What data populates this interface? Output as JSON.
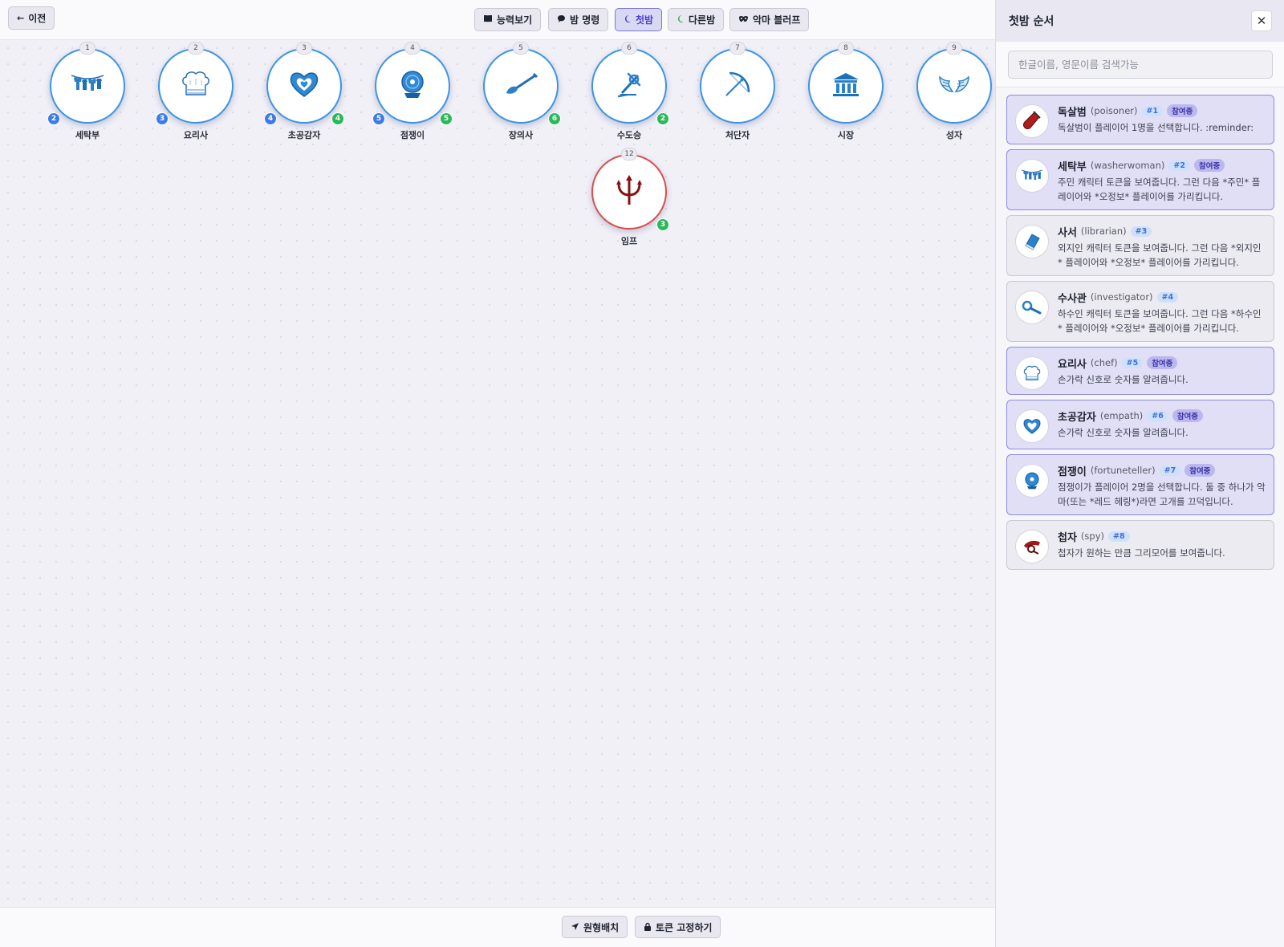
{
  "toolbar": {
    "back_label": "이전",
    "tabs": [
      {
        "label": "능력보기",
        "icon": "book-icon",
        "active": false
      },
      {
        "label": "밤 명령",
        "icon": "chat-bubble-icon",
        "active": false
      },
      {
        "label": "첫밤",
        "icon": "moon-icon",
        "active": true
      },
      {
        "label": "다른밤",
        "icon": "moon-icon",
        "active": false
      },
      {
        "label": "악마 블러프",
        "icon": "mask-icon",
        "active": false
      }
    ]
  },
  "tokens": [
    {
      "seat": "1",
      "name": "세탁부",
      "icon": "laundry-icon",
      "team": "good",
      "order": "2",
      "reminders": ""
    },
    {
      "seat": "2",
      "name": "요리사",
      "icon": "chef-hat-icon",
      "team": "good",
      "order": "3",
      "reminders": ""
    },
    {
      "seat": "3",
      "name": "초공감자",
      "icon": "heart-icon",
      "team": "good",
      "order": "4",
      "reminders": "4"
    },
    {
      "seat": "4",
      "name": "점쟁이",
      "icon": "crystal-ball-icon",
      "team": "good",
      "order": "5",
      "reminders": "5"
    },
    {
      "seat": "5",
      "name": "장의사",
      "icon": "shovel-icon",
      "team": "good",
      "order": "",
      "reminders": "6"
    },
    {
      "seat": "6",
      "name": "수도승",
      "icon": "monk-cross-icon",
      "team": "good",
      "order": "",
      "reminders": "2"
    },
    {
      "seat": "7",
      "name": "처단자",
      "icon": "bow-icon",
      "team": "good",
      "order": "",
      "reminders": ""
    },
    {
      "seat": "8",
      "name": "시장",
      "icon": "townhall-icon",
      "team": "good",
      "order": "",
      "reminders": ""
    },
    {
      "seat": "9",
      "name": "성자",
      "icon": "wings-icon",
      "team": "good",
      "order": "",
      "reminders": ""
    },
    {
      "seat": "12",
      "name": "임프",
      "icon": "trident-icon",
      "team": "evil",
      "order": "",
      "reminders": "3"
    }
  ],
  "bottom": {
    "circle_label": "원형배치",
    "lock_label": "토큰 고정하기"
  },
  "panel": {
    "title": "첫밤 순서",
    "close_label": "✕",
    "search_placeholder": "한글이름, 영문이름 검색가능",
    "cards": [
      {
        "kname": "독살범",
        "ename": "(poisoner)",
        "num": "#1",
        "joined": true,
        "joined_label": "참여중",
        "icon": "poison-vial-icon",
        "desc": "독살범이 플레이어 1명을 선택합니다. :reminder:"
      },
      {
        "kname": "세탁부",
        "ename": "(washerwoman)",
        "num": "#2",
        "joined": true,
        "joined_label": "참여중",
        "icon": "laundry-icon",
        "desc": "주민 캐릭터 토큰을 보여줍니다. 그런 다음 *주민* 플레이어와 *오정보* 플레이어를 가리킵니다."
      },
      {
        "kname": "사서",
        "ename": "(librarian)",
        "num": "#3",
        "joined": false,
        "joined_label": "",
        "icon": "book-icon",
        "desc": "외지인 캐릭터 토큰을 보여줍니다. 그런 다음 *외지인* 플레이어와 *오정보* 플레이어를 가리킵니다."
      },
      {
        "kname": "수사관",
        "ename": "(investigator)",
        "num": "#4",
        "joined": false,
        "joined_label": "",
        "icon": "magnifier-icon",
        "desc": "하수인 캐릭터 토큰을 보여줍니다. 그런 다음 *하수인* 플레이어와 *오정보* 플레이어를 가리킵니다."
      },
      {
        "kname": "요리사",
        "ename": "(chef)",
        "num": "#5",
        "joined": true,
        "joined_label": "참여중",
        "icon": "chef-hat-icon",
        "desc": "손가락 신호로 숫자를 알려줍니다."
      },
      {
        "kname": "초공감자",
        "ename": "(empath)",
        "num": "#6",
        "joined": true,
        "joined_label": "참여중",
        "icon": "heart-icon",
        "desc": "손가락 신호로 숫자를 알려줍니다."
      },
      {
        "kname": "점쟁이",
        "ename": "(fortuneteller)",
        "num": "#7",
        "joined": true,
        "joined_label": "참여중",
        "icon": "crystal-ball-icon",
        "desc": "점쟁이가 플레이어 2명을 선택합니다. 둘 중 하나가 악마(또는 *레드 헤링*)라면 고개를 끄덕입니다."
      },
      {
        "kname": "첩자",
        "ename": "(spy)",
        "num": "#8",
        "joined": false,
        "joined_label": "",
        "icon": "spy-icon",
        "desc": "첩자가 원하는 만큼 그리모어를 보여줍니다."
      }
    ]
  },
  "colors": {
    "good": "#3b94e6",
    "evil": "#de4b4b",
    "accent": "#4a3fd0"
  }
}
